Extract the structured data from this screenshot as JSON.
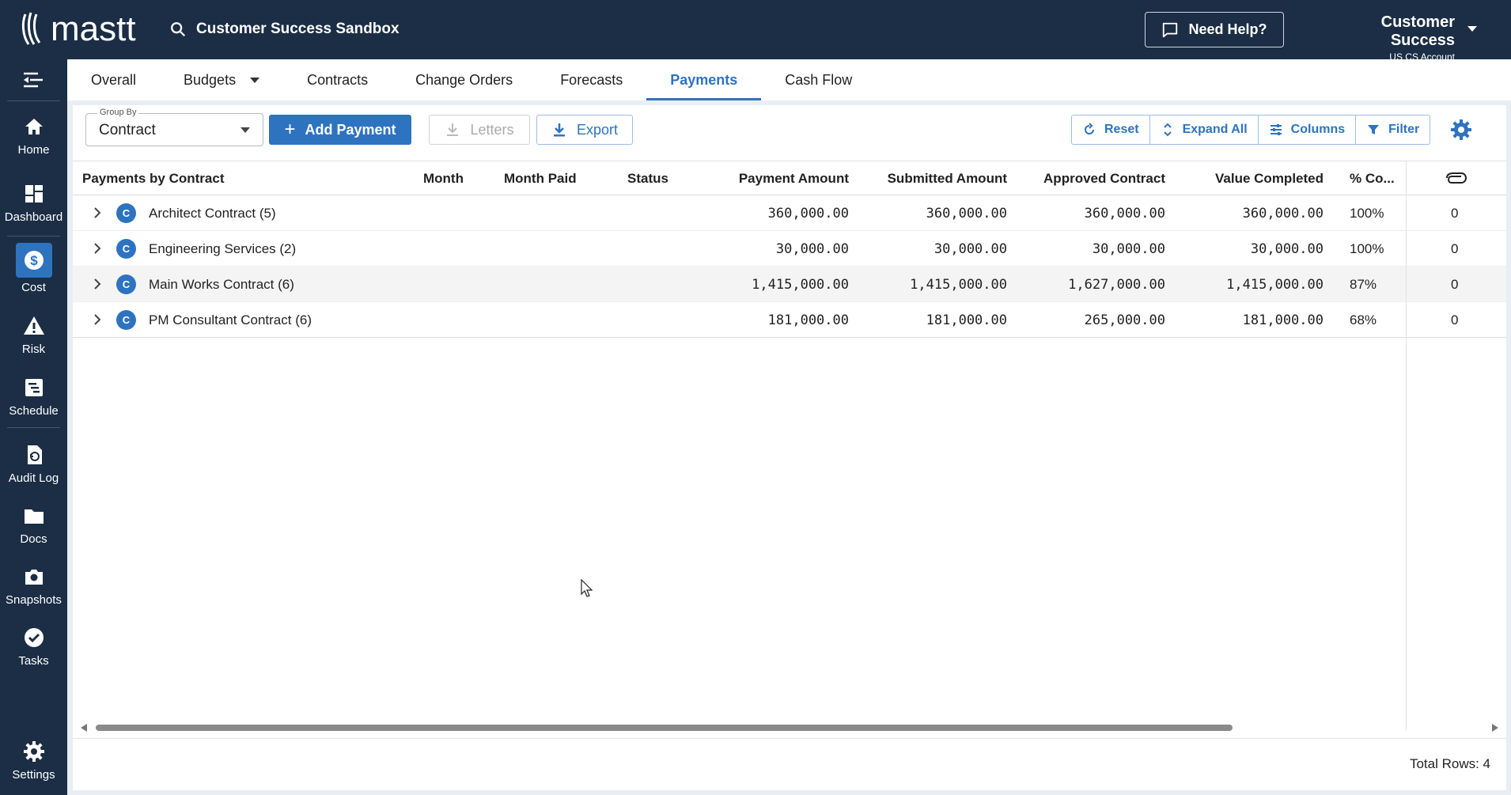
{
  "brand": {
    "name": "mastt"
  },
  "topbar": {
    "project": "Customer Success Sandbox",
    "help_label": "Need Help?",
    "account_name": "Customer Success",
    "account_sub": "US CS Account"
  },
  "sidenav": {
    "items": [
      {
        "label": "Home",
        "icon": "home-icon"
      },
      {
        "label": "Dashboard",
        "icon": "dashboard-icon"
      },
      {
        "label": "Cost",
        "icon": "dollar-icon"
      },
      {
        "label": "Risk",
        "icon": "warning-icon"
      },
      {
        "label": "Schedule",
        "icon": "schedule-icon"
      },
      {
        "label": "Audit Log",
        "icon": "audit-log-icon"
      },
      {
        "label": "Docs",
        "icon": "folder-icon"
      },
      {
        "label": "Snapshots",
        "icon": "camera-icon"
      },
      {
        "label": "Tasks",
        "icon": "check-circle-icon"
      },
      {
        "label": "Settings",
        "icon": "gear-icon"
      }
    ]
  },
  "tabs": [
    {
      "label": "Overall"
    },
    {
      "label": "Budgets"
    },
    {
      "label": "Contracts"
    },
    {
      "label": "Change Orders"
    },
    {
      "label": "Forecasts"
    },
    {
      "label": "Payments"
    },
    {
      "label": "Cash Flow"
    }
  ],
  "toolbar": {
    "groupby_label": "Group By",
    "groupby_value": "Contract",
    "add_payment": "Add Payment",
    "letters": "Letters",
    "export": "Export",
    "reset": "Reset",
    "expand_all": "Expand All",
    "columns": "Columns",
    "filter": "Filter"
  },
  "table": {
    "headers": {
      "group": "Payments by Contract",
      "month": "Month",
      "month_paid": "Month Paid",
      "status": "Status",
      "payment_amount": "Payment Amount",
      "submitted_amount": "Submitted Amount",
      "approved_contract": "Approved Contract",
      "value_completed": "Value Completed",
      "pct_complete": "% Co..."
    },
    "badge": "C",
    "rows": [
      {
        "name": "Architect Contract",
        "count": "(5)",
        "payment_amount": "360,000.00",
        "submitted_amount": "360,000.00",
        "approved_contract": "360,000.00",
        "value_completed": "360,000.00",
        "pct": "100%",
        "attachments": "0"
      },
      {
        "name": "Engineering Services",
        "count": "(2)",
        "payment_amount": "30,000.00",
        "submitted_amount": "30,000.00",
        "approved_contract": "30,000.00",
        "value_completed": "30,000.00",
        "pct": "100%",
        "attachments": "0"
      },
      {
        "name": "Main Works Contract",
        "count": "(6)",
        "payment_amount": "1,415,000.00",
        "submitted_amount": "1,415,000.00",
        "approved_contract": "1,627,000.00",
        "value_completed": "1,415,000.00",
        "pct": "87%",
        "attachments": "0"
      },
      {
        "name": "PM Consultant Contract",
        "count": "(6)",
        "payment_amount": "181,000.00",
        "submitted_amount": "181,000.00",
        "approved_contract": "265,000.00",
        "value_completed": "181,000.00",
        "pct": "68%",
        "attachments": "0"
      }
    ]
  },
  "footer": {
    "total_rows": "Total Rows: 4"
  },
  "colors": {
    "nav_bg": "#1b2e45",
    "accent": "#2d73c0"
  }
}
